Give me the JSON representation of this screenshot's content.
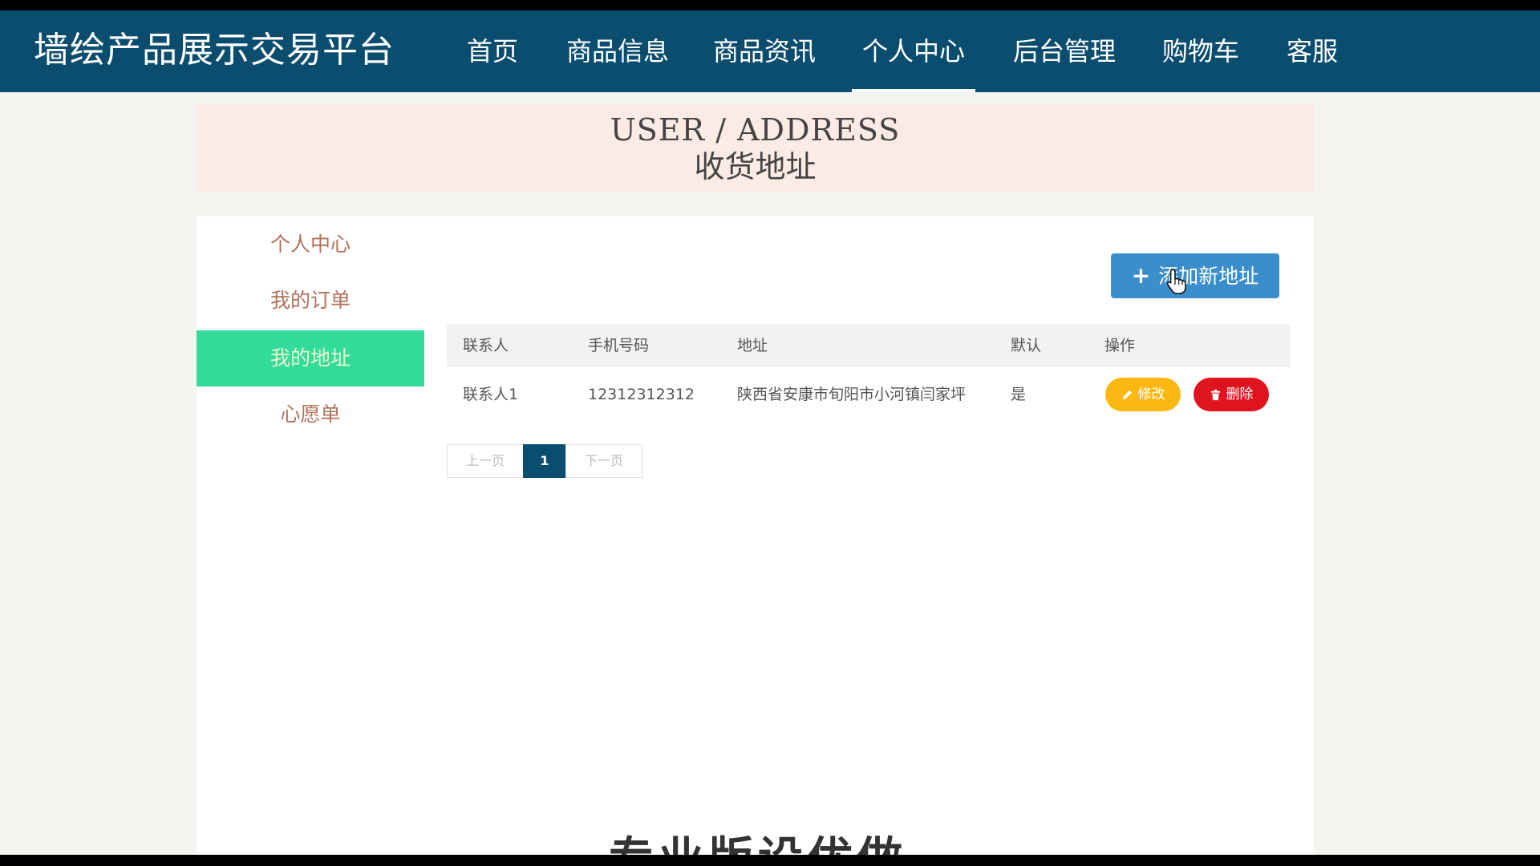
{
  "header": {
    "site_title": "墙绘产品展示交易平台",
    "nav": [
      {
        "label": "首页"
      },
      {
        "label": "商品信息"
      },
      {
        "label": "商品资讯"
      },
      {
        "label": "个人中心",
        "active": true
      },
      {
        "label": "后台管理"
      },
      {
        "label": "购物车"
      },
      {
        "label": "客服"
      }
    ]
  },
  "banner": {
    "title_en": "USER / ADDRESS",
    "title_cn": "收货地址"
  },
  "sidebar": {
    "items": [
      {
        "label": "个人中心"
      },
      {
        "label": "我的订单"
      },
      {
        "label": "我的地址",
        "active": true
      },
      {
        "label": "心愿单"
      }
    ]
  },
  "toolbar": {
    "add_label": "添加新地址",
    "add_icon": "plus-icon"
  },
  "table": {
    "columns": [
      "联系人",
      "手机号码",
      "地址",
      "默认",
      "操作"
    ],
    "rows": [
      {
        "contact": "联系人1",
        "phone": "12312312312",
        "address": "陕西省安康市旬阳市小河镇闫家坪",
        "default": "是",
        "edit_label": "修改",
        "delete_label": "删除"
      }
    ]
  },
  "pagination": {
    "prev_label": "上一页",
    "current_page": "1",
    "next_label": "下一页"
  },
  "footer": {
    "partial_text": "专业版设优做"
  },
  "colors": {
    "nav_bg": "#0b4d6e",
    "banner_bg": "#fbebe4",
    "sidebar_active": "#34dc9c",
    "add_button": "#3a8ecb",
    "edit_button": "#fbb810",
    "delete_button": "#e0141e"
  }
}
